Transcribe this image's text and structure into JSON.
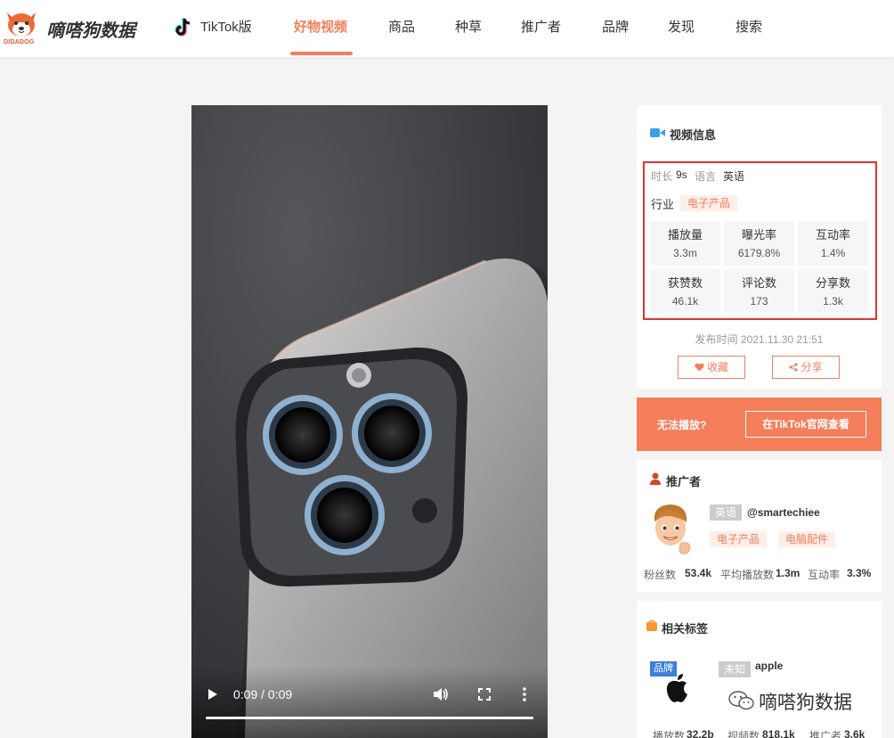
{
  "header": {
    "logo_text": "嘀嗒狗数据",
    "logo_sub": "DIDADOG",
    "nav": [
      {
        "label": "TikTok版",
        "active": false
      },
      {
        "label": "好物视频",
        "active": true
      },
      {
        "label": "商品",
        "active": false
      },
      {
        "label": "种草",
        "active": false
      },
      {
        "label": "推广者",
        "active": false
      },
      {
        "label": "品牌",
        "active": false
      },
      {
        "label": "发现",
        "active": false
      },
      {
        "label": "搜索",
        "active": false
      }
    ]
  },
  "video_player": {
    "time_display": "0:09 / 0:09",
    "progress_fraction": 1.0
  },
  "video_info": {
    "title": "视频信息",
    "duration_label": "时长",
    "duration_value": "9s",
    "language_label": "语言",
    "language_value": "英语",
    "industry_label": "行业",
    "industry_tag": "电子产品",
    "stats": [
      {
        "label": "播放量",
        "value": "3.3m"
      },
      {
        "label": "曝光率",
        "value": "6179.8%"
      },
      {
        "label": "互动率",
        "value": "1.4%"
      },
      {
        "label": "获赞数",
        "value": "46.1k"
      },
      {
        "label": "评论数",
        "value": "173"
      },
      {
        "label": "分享数",
        "value": "1.3k"
      }
    ],
    "publish_label": "发布时间",
    "publish_time": "2021.11.30 21:51",
    "favorite_button": "收藏",
    "share_button": "分享"
  },
  "banner": {
    "text": "无法播放?",
    "button": "在TikTok官网查看"
  },
  "promoter": {
    "title": "推广者",
    "language_tag": "英语",
    "handle": "@smartechiee",
    "tags": [
      "电子产品",
      "电脑配件"
    ],
    "metrics": [
      {
        "label": "粉丝数",
        "value": "53.4k"
      },
      {
        "label": "平均播放数",
        "value": "1.3m"
      },
      {
        "label": "互动率",
        "value": "3.3%"
      }
    ]
  },
  "related_tags": {
    "title": "相关标签",
    "brand_badge": "品牌",
    "unknown_tag": "未知",
    "brand_name": "apple",
    "metrics": [
      {
        "label": "播放数",
        "value": "32.2b"
      },
      {
        "label": "视频数",
        "value": "818.1k"
      },
      {
        "label": "推广者",
        "value": "3.6k"
      }
    ]
  },
  "watermark": {
    "text": "嘀嗒狗数据"
  },
  "colors": {
    "accent": "#f57e5b",
    "highlight_border": "#e03333",
    "brand_badge": "#3d7fd9",
    "video_icon": "#3aa0e6"
  }
}
